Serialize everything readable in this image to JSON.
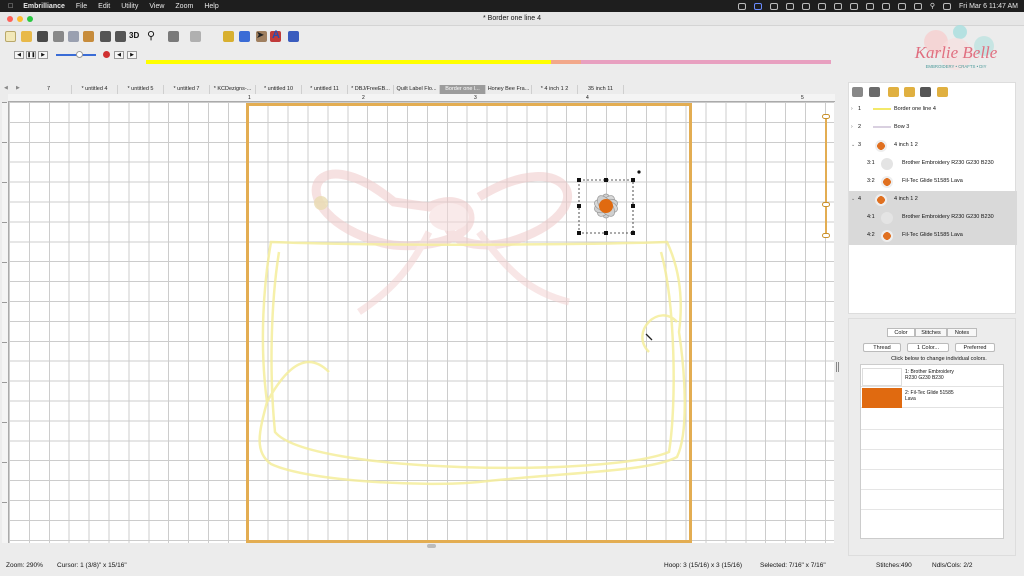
{
  "menubar": {
    "app_name": "Embrilliance",
    "items": [
      "File",
      "Edit",
      "Utility",
      "View",
      "Zoom",
      "Help"
    ],
    "datetime": "Fri Mar 6 11:47 AM"
  },
  "window": {
    "title": "* Border one line 4",
    "close_color": "#fe5f57",
    "minimize_color": "#febc2e",
    "maximize_color": "#28c840"
  },
  "toolbar": {
    "label_3d": "3D",
    "label_text": "A"
  },
  "progress": {
    "colors": [
      "#ffff00",
      "#f2a88a",
      "#e8a0c0"
    ]
  },
  "tabs": [
    "7",
    "* untitled 4",
    "* untitled 5",
    "* untitled 7",
    "* KCDezigns-...",
    "* untitled 10",
    "* untitled 11",
    "* DBJ/FreeEB...",
    "Quilt Label Flo...",
    "Border one l...",
    "Honey Bee Fra...",
    "* 4 inch 1 2",
    "35 inch 11"
  ],
  "active_tab_index": 9,
  "ruler": {
    "marks": [
      "1",
      "2",
      "3",
      "4",
      "5"
    ]
  },
  "logo": {
    "name": "Karlie Belle",
    "tagline": "EMBROIDERY • CRAFTS • DIY"
  },
  "objects": [
    {
      "num": "1",
      "label": "Border one line 4",
      "indent": 0,
      "expander": ">",
      "selected": false
    },
    {
      "num": "2",
      "label": "Bow 3",
      "indent": 0,
      "expander": ">",
      "selected": false
    },
    {
      "num": "3",
      "label": "4 inch 1 2",
      "indent": 0,
      "expander": "v",
      "selected": false,
      "swatch": "#e07020"
    },
    {
      "num": "3:1",
      "label": "Brother Embroidery R230 G230 B230",
      "indent": 1,
      "selected": false,
      "swatch": "#e4e4e4"
    },
    {
      "num": "3:2",
      "label": "Fil-Tec Glide 51585 Lava",
      "indent": 1,
      "selected": false,
      "swatch": "#e07020"
    },
    {
      "num": "4",
      "label": "4 inch 1 2",
      "indent": 0,
      "expander": "v",
      "selected": true,
      "swatch": "#e07020"
    },
    {
      "num": "4:1",
      "label": "Brother Embroidery R230 G230 B230",
      "indent": 1,
      "selected": true,
      "swatch": "#e4e4e4"
    },
    {
      "num": "4:2",
      "label": "Fil-Tec Glide 51585 Lava",
      "indent": 1,
      "selected": true,
      "swatch": "#e07020"
    }
  ],
  "color_panel": {
    "tabs": [
      "Color",
      "Stitches",
      "Notes"
    ],
    "buttons": [
      "Thread",
      "1 Color...",
      "Preferred"
    ],
    "hint": "Click below to change individual colors.",
    "colors": [
      {
        "label": "1: Brother Embroidery R230 G230 B230",
        "swatch": "#ffffff"
      },
      {
        "label": "2: Fil-Tec Glide 51585 Lava",
        "swatch": "#e06a10"
      }
    ]
  },
  "status": {
    "zoom": "Zoom: 290%",
    "cursor": "Cursor: 1 (3/8)\" x 15/16\"",
    "hoop": "Hoop: 3 (15/16) x 3 (15/16)",
    "selected": "Selected: 7/16\" x 7/16\"",
    "stitches": "Stitches:490",
    "ndls": "Ndls/Cols: 2/2"
  },
  "colors": {
    "hoop": "#e3ad52",
    "selection_bg": "#d9d9d9",
    "flower_petal": "#c8c8c8",
    "flower_center": "#e06a10",
    "border_yellow": "#f7f1a0",
    "bow_pink": "#f3dcdc"
  }
}
